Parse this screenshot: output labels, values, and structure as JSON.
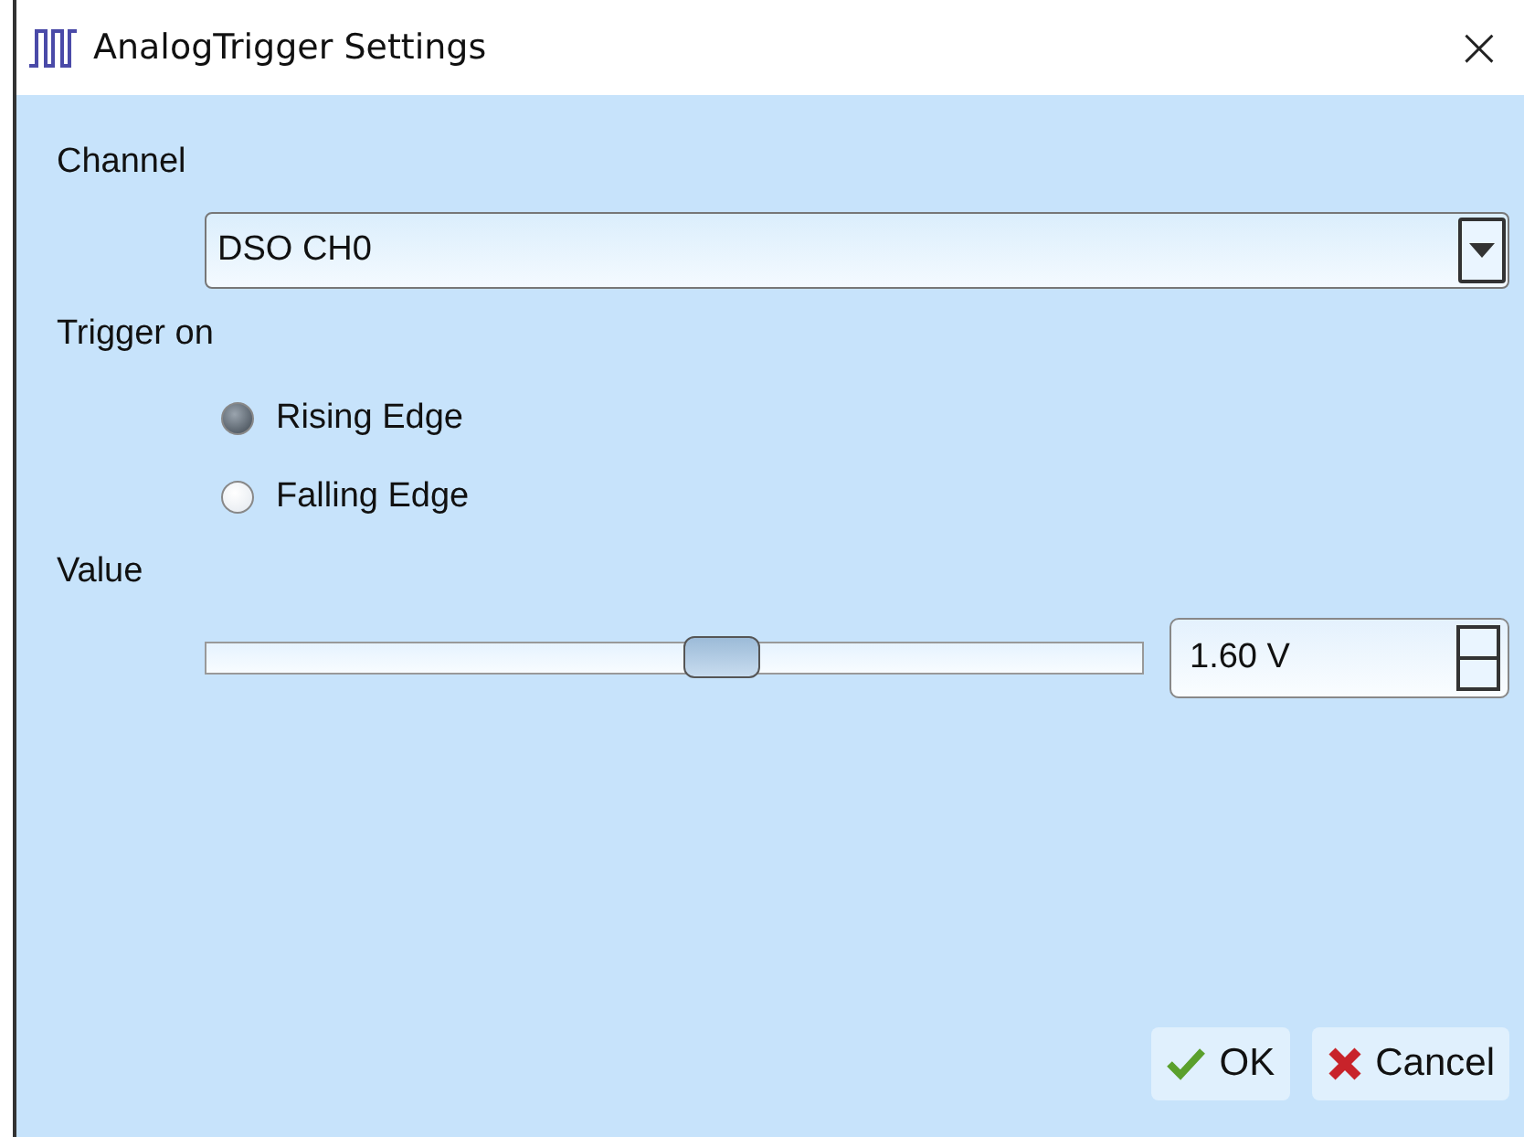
{
  "window": {
    "title": "AnalogTrigger Settings",
    "close": "×"
  },
  "channel": {
    "label": "Channel",
    "value": "DSO CH0"
  },
  "trigger": {
    "label": "Trigger on",
    "options": [
      {
        "label": "Rising Edge",
        "selected": true
      },
      {
        "label": "Falling Edge",
        "selected": false
      }
    ]
  },
  "value": {
    "label": "Value",
    "level": 0.55,
    "reading": "1.60 V"
  },
  "buttons": [
    {
      "kind": "ok",
      "label": "OK"
    },
    {
      "kind": "cancel",
      "label": "Cancel"
    }
  ]
}
